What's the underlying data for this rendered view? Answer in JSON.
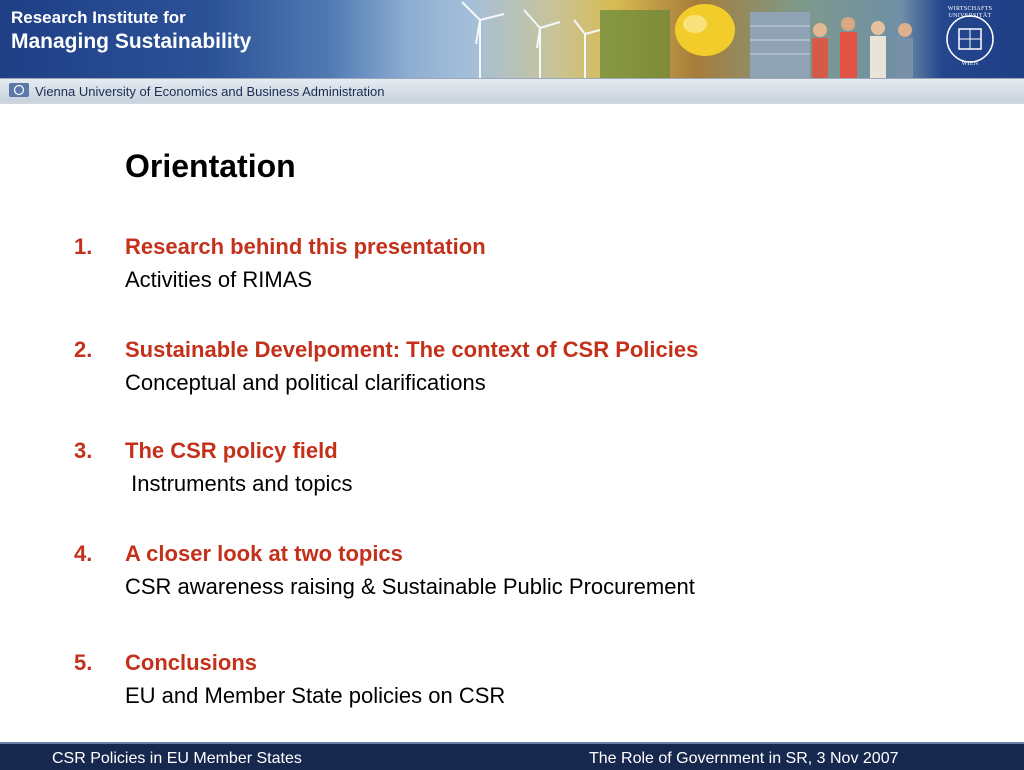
{
  "header": {
    "institute_line1": "Research Institute for",
    "institute_line2": "Managing Sustainability",
    "university": "Vienna University of Economics and Business Administration",
    "seal_top": "WIRTSCHAFTS",
    "seal_top2": "UNIVERSITÄT",
    "seal_bottom": "WIEN"
  },
  "slide": {
    "title": "Orientation",
    "items": [
      {
        "number": "1.",
        "heading": "Research behind this presentation",
        "detail": "Activities of RIMAS"
      },
      {
        "number": "2.",
        "heading": "Sustainable Develpoment: The context of CSR Policies",
        "detail": "Conceptual and political clarifications"
      },
      {
        "number": "3.",
        "heading": "The CSR policy field",
        "detail": " Instruments and topics"
      },
      {
        "number": "4.",
        "heading": "A closer look at two topics",
        "detail": "CSR awareness raising & Sustainable Public Procurement"
      },
      {
        "number": "5.",
        "heading": "Conclusions",
        "detail": "EU and Member State policies on CSR"
      }
    ]
  },
  "footer": {
    "left": "CSR Policies in EU Member States",
    "right": "The Role of Government in SR, 3 Nov 2007"
  },
  "colors": {
    "heading": "#c4311b",
    "footer_bg": "#17284f",
    "banner_blue": "#1f3f86"
  }
}
